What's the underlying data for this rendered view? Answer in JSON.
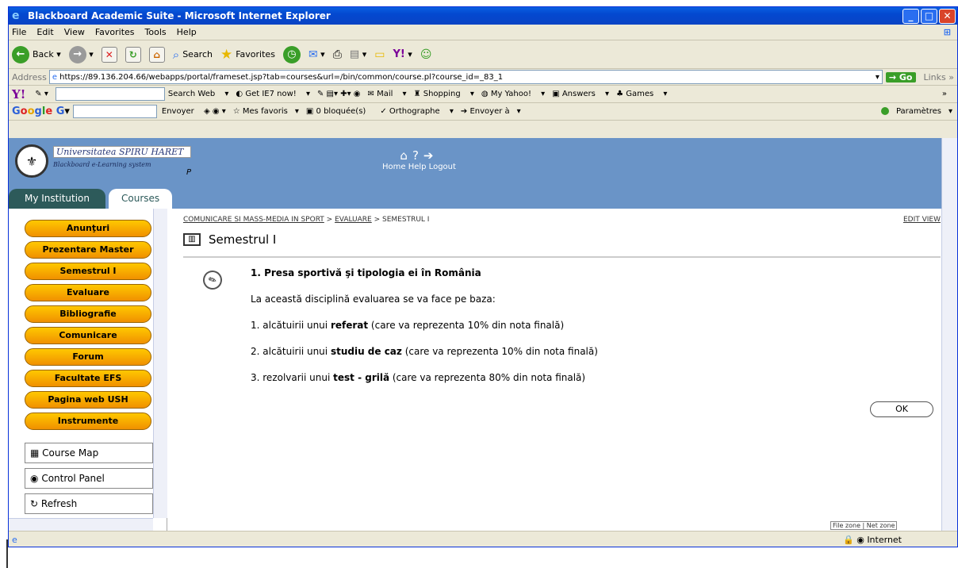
{
  "window": {
    "title": "Blackboard Academic Suite - Microsoft Internet Explorer"
  },
  "menu": [
    "File",
    "Edit",
    "View",
    "Favorites",
    "Tools",
    "Help"
  ],
  "toolbar": {
    "back": "Back",
    "search": "Search",
    "favorites": "Favorites"
  },
  "address": {
    "label": "Address",
    "url": "https://89.136.204.66/webapps/portal/frameset.jsp?tab=courses&url=/bin/common/course.pl?course_id=_83_1",
    "go": "Go",
    "links": "Links"
  },
  "yahoo": {
    "items": [
      "Search Web",
      "Get IE7 now!",
      "Mail",
      "Shopping",
      "My Yahoo!",
      "Answers",
      "Games"
    ]
  },
  "google": {
    "items": [
      "Envoyer",
      "Mes favoris",
      "0 bloquée(s)",
      "Orthographe",
      "Envoyer à"
    ],
    "settings": "Paramètres"
  },
  "bb": {
    "university": "Universitatea SPIRU HARET",
    "system": "Blackboard e-Learning system",
    "p": "P",
    "nav": "Home  Help  Logout",
    "tabs": [
      "My Institution",
      "Courses"
    ]
  },
  "sidebar": {
    "buttons": [
      "Anunţuri",
      "Prezentare Master",
      "Semestrul I",
      "Evaluare",
      "Bibliografie",
      "Comunicare",
      "Forum",
      "Facultate EFS",
      "Pagina web USH",
      "Instrumente"
    ],
    "tools": [
      "Course Map",
      "Control Panel",
      "Refresh"
    ]
  },
  "main": {
    "crumb1": "COMUNICARE SI MASS-MEDIA IN SPORT",
    "crumb2": "EVALUARE",
    "crumb3": "SEMESTRUL I",
    "editview": "EDIT VIEW",
    "title": "Semestrul I",
    "heading": "1. Presa sportivă şi tipologia ei în România",
    "intro": "La această disciplină evaluarea se va face pe baza:",
    "items": [
      {
        "pre": "1. alcătuirii unui ",
        "b": "referat",
        "post": " (care va reprezenta 10% din nota finală)"
      },
      {
        "pre": "2. alcătuirii unui ",
        "b": "studiu de caz",
        "post": " (care va reprezenta 10% din nota finală)"
      },
      {
        "pre": "3. rezolvarii unui ",
        "b": "test - grilă",
        "post": " (care va reprezenta 80% din nota finală)"
      }
    ],
    "ok": "OK"
  },
  "status": {
    "zones": "File zone | Net zone",
    "zone": "Internet"
  }
}
